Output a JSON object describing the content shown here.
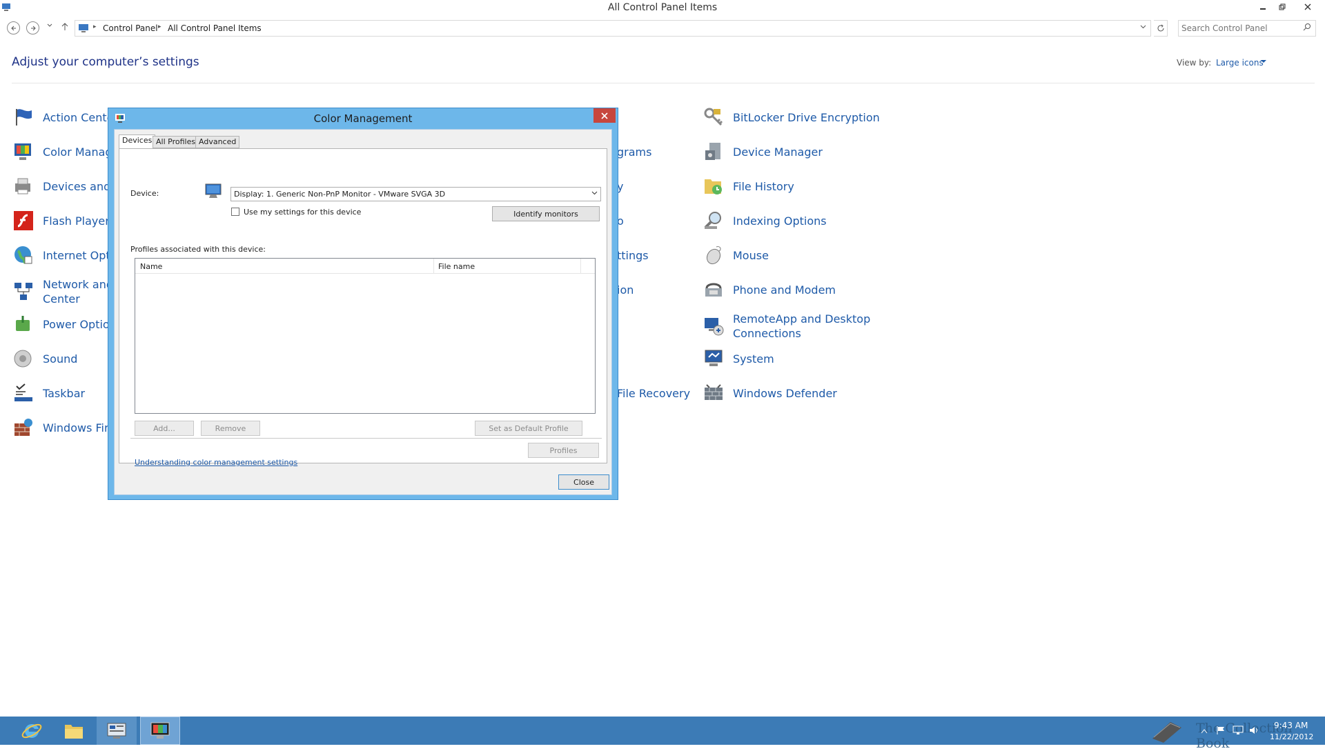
{
  "window": {
    "title": "All Control Panel Items",
    "breadcrumbs": [
      "Control Panel",
      "All Control Panel Items"
    ],
    "search_placeholder": "Search Control Panel"
  },
  "content": {
    "heading": "Adjust your computer’s settings",
    "view_by_label": "View by:",
    "view_by_value": "Large icons"
  },
  "column1": [
    {
      "label": "Action Center",
      "icon": "flag-icon"
    },
    {
      "label": "Color Manage",
      "icon": "color-management-icon"
    },
    {
      "label": "Devices and P",
      "icon": "printer-icon"
    },
    {
      "label": "Flash Player (",
      "icon": "flash-icon"
    },
    {
      "label": "Internet Optic",
      "icon": "globe-icon"
    },
    {
      "label": "Network and\nCenter",
      "icon": "network-icon"
    },
    {
      "label": "Power Option",
      "icon": "power-icon"
    },
    {
      "label": "Sound",
      "icon": "speaker-icon"
    },
    {
      "label": "Taskbar",
      "icon": "taskbar-icon"
    },
    {
      "label": "Windows Fire",
      "icon": "firewall-icon"
    }
  ],
  "column2": [
    {
      "label": "grams"
    },
    {
      "label": "y"
    },
    {
      "label": "o"
    },
    {
      "label": "ttings"
    },
    {
      "label": "ion"
    },
    {
      "label": "File Recovery"
    }
  ],
  "column3": [
    {
      "label": "BitLocker Drive Encryption",
      "icon": "key-icon"
    },
    {
      "label": "Device Manager",
      "icon": "device-manager-icon"
    },
    {
      "label": "File History",
      "icon": "file-history-icon"
    },
    {
      "label": "Indexing Options",
      "icon": "magnifier-icon"
    },
    {
      "label": "Mouse",
      "icon": "mouse-icon"
    },
    {
      "label": "Phone and Modem",
      "icon": "phone-icon"
    },
    {
      "label": "RemoteApp and Desktop\nConnections",
      "icon": "remote-icon"
    },
    {
      "label": "System",
      "icon": "system-icon"
    },
    {
      "label": "Windows Defender",
      "icon": "defender-icon"
    }
  ],
  "dialog": {
    "title": "Color Management",
    "tabs": [
      "Devices",
      "All Profiles",
      "Advanced"
    ],
    "device_label": "Device:",
    "device_value": "Display: 1. Generic Non-PnP Monitor - VMware SVGA 3D",
    "use_settings_label": "Use my settings for this device",
    "identify_button": "Identify monitors",
    "profiles_label": "Profiles associated with this device:",
    "columns": [
      "Name",
      "File name"
    ],
    "add_button": "Add...",
    "remove_button": "Remove",
    "default_button": "Set as Default Profile",
    "profiles_button": "Profiles",
    "help_link": "Understanding color management settings",
    "close_button": "Close"
  },
  "taskbar": {
    "watermark": "The Collection Book",
    "time": "9:43 AM",
    "date": "11/22/2012"
  },
  "colors": {
    "link": "#1e5aa8",
    "heading": "#1e3287",
    "dialog_frame": "#6db7ea",
    "close_red": "#c7463d",
    "taskbar": "#3c7bb6"
  }
}
